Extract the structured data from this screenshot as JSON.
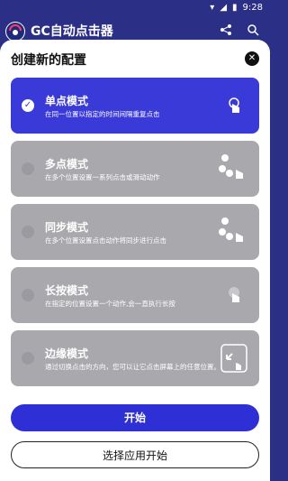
{
  "status": {
    "time": "9:28"
  },
  "appbar": {
    "title": "GC自动点击器"
  },
  "sheet": {
    "heading": "创建新的配置",
    "cards": [
      {
        "name": "单点模式",
        "desc": "在同一位置以指定的时间间隔重复点击",
        "selected": true,
        "icon": "single-tap-icon"
      },
      {
        "name": "多点模式",
        "desc": "在多个位置设置一系列点击或滑动动作",
        "selected": false,
        "icon": "multi-tap-icon"
      },
      {
        "name": "同步模式",
        "desc": "在多个位置设置点击动作将同步进行点击",
        "selected": false,
        "icon": "sync-tap-icon"
      },
      {
        "name": "长按模式",
        "desc": "在指定的位置设置一个动作,会一直执行长按",
        "selected": false,
        "icon": "long-press-icon"
      },
      {
        "name": "边缘模式",
        "desc": "通过切换点击的方向，您可以让它点击屏幕上的任意位置。",
        "selected": false,
        "icon": "edge-tap-icon"
      }
    ],
    "buttons": {
      "start": "开始",
      "choose_app": "选择应用开始"
    }
  }
}
